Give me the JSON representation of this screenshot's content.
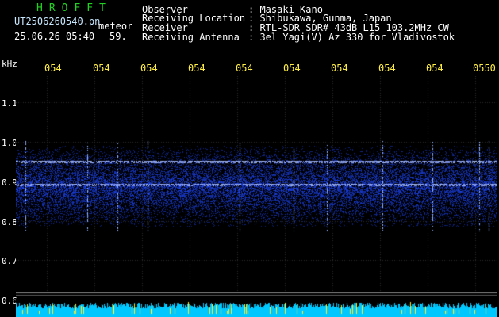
{
  "header": {
    "title": "HROFFT",
    "filename": "UT2506260540.pn",
    "meteor_label": "meteor",
    "datetime": "25.06.26 05:40",
    "count": "59.",
    "observer_label": "Observer",
    "observer_value": ": Masaki Kano",
    "location_label": "Receiving Location",
    "location_value": ": Shibukawa, Gunma, Japan",
    "receiver_label": "Receiver",
    "receiver_value": ": RTL-SDR SDR# 43dB L15 103.2MHz CW",
    "antenna_label": "Receiving Antenna",
    "antenna_value": ": 3el Yagi(V) Az 330 for Vladivostok"
  },
  "axis": {
    "unit": "kHz",
    "khz_labels": [
      "1.1",
      "1.0",
      "0.9",
      "0.8",
      "0.7",
      "0.6"
    ],
    "time_labels": [
      "054",
      "054",
      "054",
      "054",
      "054",
      "054",
      "054",
      "054",
      "054",
      "0550"
    ]
  },
  "colors": {
    "background": "#000000",
    "title": "#22d222",
    "time_label": "#ffee44",
    "band": "#2a46ff",
    "echo_line": "#c8e0ff",
    "bottom_bar": "#00c8ff"
  }
}
